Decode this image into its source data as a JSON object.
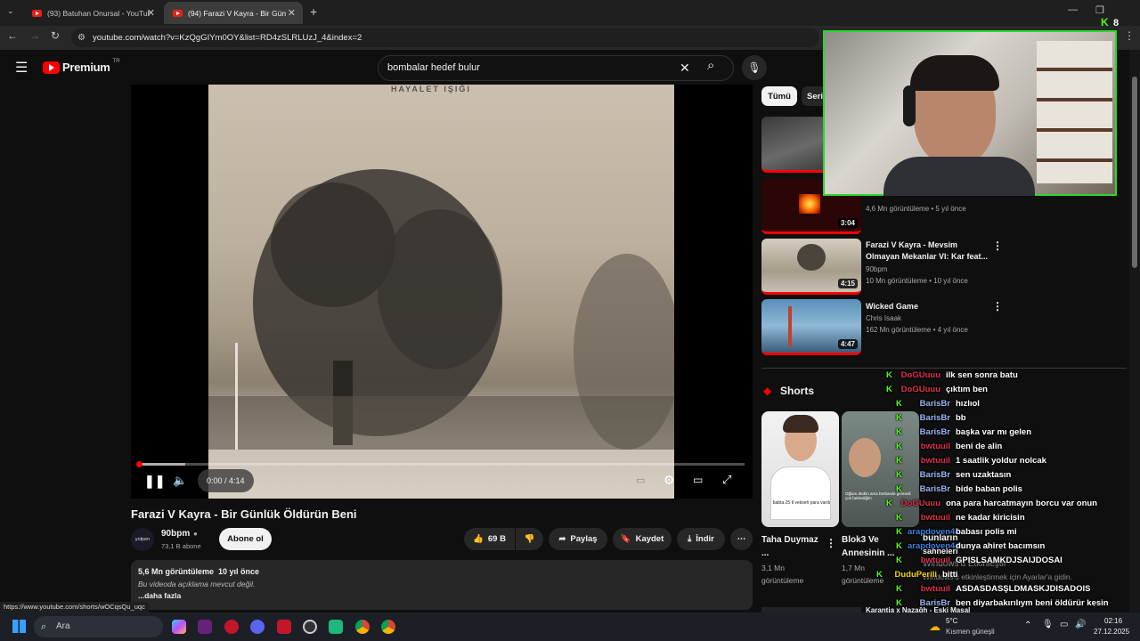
{
  "browser": {
    "tabs": [
      {
        "label": "(93) Batuhan Onursal - YouTube",
        "active": false
      },
      {
        "label": "(94) Farazi V Kayra - Bir Gün",
        "active": true
      }
    ],
    "new_tab_icon": "plus-icon",
    "url": "youtube.com/watch?v=KzQgGIYm0OY&list=RD4zSLRLUzJ_4&index=2",
    "status_url": "https://www.youtube.com/shorts/wOCqsQu_uqc"
  },
  "header": {
    "logo": "Premium",
    "logo_region": "TR",
    "search_value": "bombalar hedef bulur"
  },
  "player": {
    "frame_caption": "HAYALET IŞIĞI",
    "time": "0:00 / 4:14",
    "progress": 0.0
  },
  "video": {
    "title": "Farazi V Kayra - Bir Günlük Öldürün Beni",
    "channel": "90bpm",
    "channel_avatar": "yolpen",
    "subscribers": "73,1 B abone",
    "subscribe_label": "Abone ol",
    "likes": "69 B",
    "share_label": "Paylaş",
    "save_label": "Kaydet",
    "download_label": "İndir",
    "views_line": "5,6 Mn görüntüleme  10 yıl önce",
    "no_desc": "Bu videoda açıklama mevcut değil.",
    "more": "...daha fazla"
  },
  "filters": [
    "Tümü",
    "Seri"
  ],
  "related": [
    {
      "title": "",
      "meta1": "",
      "meta2": "",
      "duration": ""
    },
    {
      "title": "",
      "meta1": "",
      "meta2": "4,6 Mn görüntüleme • 5 yıl önce",
      "duration": "3:04"
    },
    {
      "title": "Farazi V Kayra - Mevsim Olmayan Mekanlar VI: Kar feat...",
      "meta1": "90bpm",
      "meta2": "10 Mn görüntüleme • 10 yıl önce",
      "duration": "4:15"
    },
    {
      "title": "Wicked Game",
      "meta1": "Chris Isaak",
      "meta2": "162 Mn görüntüleme • 4 yıl önce",
      "duration": "4:47"
    }
  ],
  "shorts": {
    "heading": "Shorts",
    "items": [
      {
        "title": "Taha Duymaz ...",
        "views": "3,1 Mn görüntüleme",
        "thumb_text": "babta 25 tl vekseh para vardı"
      },
      {
        "title": "Blok3 Ve Annesinin ...",
        "views": "1,7 Mn görüntüleme",
        "thumb_text": "Oğlum dedim ama herbasıle gelmedi çok beklediğim"
      }
    ],
    "partial_text": "sahneleri",
    "partial_title": "bunların"
  },
  "footer_partial": "Karantia x Nazağh - Eski Masal",
  "windows_activate": {
    "line1": "Windows'u Etkinleştir",
    "line2": "Windows'u etkinleştirmek için Ayarlar'a gidin."
  },
  "webcam": {
    "viewer_count": "8"
  },
  "chat": [
    {
      "user": "DoGUuuu",
      "msg": "ilk sen sonra batu",
      "color": "#e0304a"
    },
    {
      "user": "DoGUuuu",
      "msg": "çıktım ben",
      "color": "#e0304a"
    },
    {
      "user": "BarisBr",
      "msg": "hızlıol",
      "color": "#9ab4f2"
    },
    {
      "user": "BarisBr",
      "msg": "bb",
      "color": "#9ab4f2"
    },
    {
      "user": "BarisBr",
      "msg": "başka var mı gelen",
      "color": "#9ab4f2"
    },
    {
      "user": "bwtuuil",
      "msg": "beni de alin",
      "color": "#e0304a"
    },
    {
      "user": "bwtuuil",
      "msg": "1 saatlik yoldur nolcak",
      "color": "#e0304a"
    },
    {
      "user": "BarisBr",
      "msg": "sen uzaktasın",
      "color": "#9ab4f2"
    },
    {
      "user": "BarisBr",
      "msg": "bide baban polis",
      "color": "#9ab4f2"
    },
    {
      "user": "DoGUuuu",
      "msg": "ona para harcatmayın borcu var onun",
      "color": "#e0304a"
    },
    {
      "user": "bwtuuil",
      "msg": "ne kadar kiricisin",
      "color": "#e0304a"
    },
    {
      "user": "arapdoven44",
      "msg": "babası polis mi",
      "color": "#3f7fe0"
    },
    {
      "user": "arapdoven44",
      "msg": "dunya ahiret bacımsın",
      "color": "#3f7fe0"
    },
    {
      "user": "bwtuuil",
      "msg": "GPISLSAMKDJSAIJDOSAI",
      "color": "#e0304a"
    },
    {
      "user": "DuduPerili",
      "msg": "bitti",
      "color": "#f0d21c"
    },
    {
      "user": "bwtuuil",
      "msg": "ASDASDASŞLDMASKJDISADOIS",
      "color": "#e0304a"
    },
    {
      "user": "BarisBr",
      "msg": "ben diyarbakırılıym beni öldürür kesin",
      "color": "#9ab4f2"
    }
  ],
  "taskbar": {
    "search_label": "Ara",
    "weather_temp": "5°C",
    "weather_desc": "Kısmen güneşli",
    "time": "02:16",
    "date": "27.12.2025"
  },
  "colors": {
    "accent": "#ff0000",
    "kick_green": "#53fc18"
  }
}
